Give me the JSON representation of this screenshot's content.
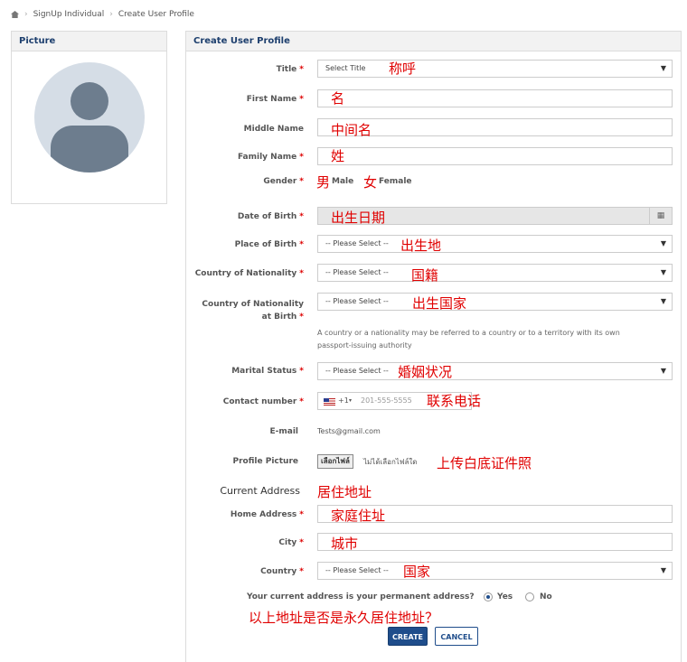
{
  "breadcrumb": {
    "items": [
      "SignUp Individual",
      "Create User Profile"
    ]
  },
  "picture_panel": {
    "title": "Picture"
  },
  "form": {
    "title": "Create User Profile",
    "title_field": {
      "label": "Title",
      "value": "Select Title",
      "annotation": "称呼"
    },
    "first_name": {
      "label": "First Name",
      "annotation": "名"
    },
    "middle_name": {
      "label": "Middle Name",
      "annotation": "中间名"
    },
    "family_name": {
      "label": "Family Name",
      "annotation": "姓"
    },
    "gender": {
      "label": "Gender",
      "male_cn": "男",
      "male": "Male",
      "female_cn": "女",
      "female": "Female"
    },
    "dob": {
      "label": "Date of Birth",
      "annotation": "出生日期"
    },
    "place_of_birth": {
      "label": "Place of Birth",
      "value": "-- Please Select --",
      "annotation": "出生地"
    },
    "nationality": {
      "label": "Country of Nationality",
      "value": "-- Please Select --",
      "annotation": "国籍"
    },
    "nationality_birth": {
      "label_line1": "Country of Nationality",
      "label_line2": "at Birth",
      "value": "-- Please Select --",
      "annotation": "出生国家"
    },
    "nationality_note_line1": "A country or a nationality may be referred to a country or to a territory with its own",
    "nationality_note_line2": "passport-issuing authority",
    "marital": {
      "label": "Marital Status",
      "value": "-- Please Select --",
      "annotation": "婚姻状况"
    },
    "contact": {
      "label": "Contact number",
      "code": "+1",
      "placeholder": "201-555-5555",
      "annotation": "联系电话"
    },
    "email": {
      "label": "E-mail",
      "value": "Tests@gmail.com"
    },
    "profile_picture": {
      "label": "Profile Picture",
      "button": "เลือกไฟล์",
      "status": "ไม่ได้เลือกไฟล์ใด",
      "annotation": "上传白底证件照"
    },
    "current_address": {
      "label": "Current Address",
      "annotation": "居住地址"
    },
    "home_address": {
      "label": "Home Address",
      "annotation": "家庭住址"
    },
    "city": {
      "label": "City",
      "annotation": "城市"
    },
    "country": {
      "label": "Country",
      "value": "-- Please Select --",
      "annotation": "国家"
    },
    "permanent_question": "Your current address is your permanent address?",
    "yes": "Yes",
    "no": "No",
    "permanent_annotation": "以上地址是否是永久居住地址？",
    "create_button": "CREATE",
    "cancel_button": "CANCEL"
  },
  "required_mark": "*",
  "colors": {
    "heading": "#1d3f6e",
    "annotation": "#e00000",
    "primary_button": "#1f4d8b"
  }
}
